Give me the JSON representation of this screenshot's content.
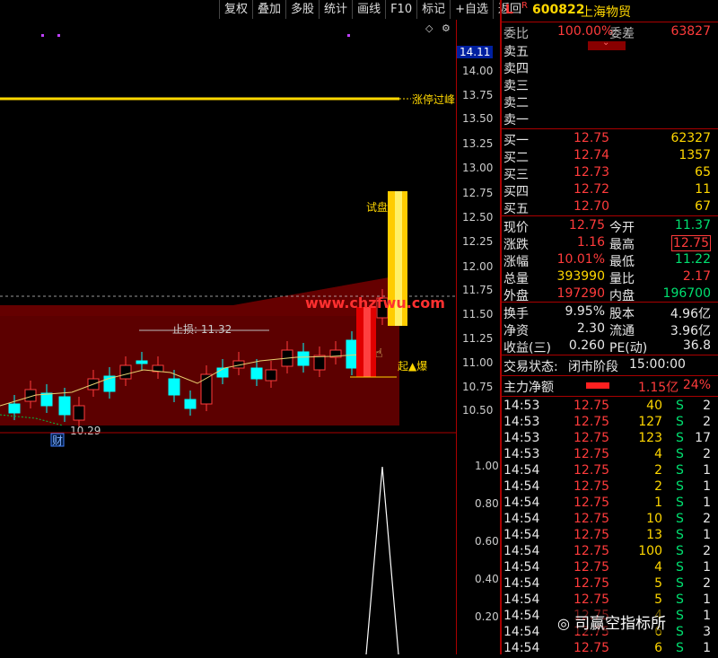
{
  "toolbar": [
    "复权",
    "叠加",
    "多股",
    "统计",
    "画线",
    "F10",
    "标记",
    "+自选",
    "返回"
  ],
  "chart": {
    "price_labels": [
      "14.11",
      "14.00",
      "13.75",
      "13.50",
      "13.25",
      "13.00",
      "12.75",
      "12.50",
      "12.25",
      "12.00",
      "11.75",
      "11.50",
      "11.25",
      "11.00",
      "10.75",
      "10.50"
    ],
    "current_price_tag": "14.11",
    "limit_line_label": "涨停过峰",
    "stop_label": "止损: 11.32",
    "low_label": "10.29",
    "cai_label": "财",
    "test_label": "试盘",
    "burst_label": "起▲爆",
    "watermark": "www.chzfwu.com",
    "indicator_labels": [
      "1.00",
      "0.80",
      "0.60",
      "0.40",
      "0.20"
    ],
    "colors": {
      "limit_line": "#ffd700",
      "up": "#ff3b3b",
      "down": "#00ffff",
      "band": "#5a0000"
    }
  },
  "header": {
    "tag_l": "L",
    "tag_r": "R",
    "code": "600822",
    "name": "上海物贸"
  },
  "weibi": {
    "label": "委比",
    "value": "100.00%",
    "label2": "委差",
    "value2": "63827"
  },
  "sell": [
    {
      "label": "卖五"
    },
    {
      "label": "卖四"
    },
    {
      "label": "卖三"
    },
    {
      "label": "卖二"
    },
    {
      "label": "卖一"
    }
  ],
  "buy": [
    {
      "label": "买一",
      "price": "12.75",
      "vol": "62327"
    },
    {
      "label": "买二",
      "price": "12.74",
      "vol": "1357"
    },
    {
      "label": "买三",
      "price": "12.73",
      "vol": "65"
    },
    {
      "label": "买四",
      "price": "12.72",
      "vol": "11"
    },
    {
      "label": "买五",
      "price": "12.70",
      "vol": "67"
    }
  ],
  "quote": [
    {
      "l1": "现价",
      "v1": "12.75",
      "l2": "今开",
      "v2": "11.37",
      "c1": "red",
      "c2": "green"
    },
    {
      "l1": "涨跌",
      "v1": "1.16",
      "l2": "最高",
      "v2": "12.75",
      "c1": "red",
      "c2": "red"
    },
    {
      "l1": "涨幅",
      "v1": "10.01%",
      "l2": "最低",
      "v2": "11.22",
      "c1": "red",
      "c2": "green"
    },
    {
      "l1": "总量",
      "v1": "393990",
      "l2": "量比",
      "v2": "2.17",
      "c1": "yellow",
      "c2": "red"
    },
    {
      "l1": "外盘",
      "v1": "197290",
      "l2": "内盘",
      "v2": "196700",
      "c1": "red",
      "c2": "green"
    }
  ],
  "stats": [
    {
      "l1": "换手",
      "v1": "9.95%",
      "l2": "股本",
      "v2": "4.96亿"
    },
    {
      "l1": "净资",
      "v1": "2.30",
      "l2": "流通",
      "v2": "3.96亿"
    },
    {
      "l1": "收益(三)",
      "v1": "0.260",
      "l2": "PE(动)",
      "v2": "36.8"
    }
  ],
  "trade_status": {
    "label": "交易状态:",
    "phase": "闭市阶段",
    "time": "15:00:00"
  },
  "main_flow": {
    "label": "主力净额",
    "value": "1.15亿",
    "pct": "24%"
  },
  "ticks": [
    {
      "t": "14:53",
      "p": "12.75",
      "v": "40",
      "s": "S",
      "n": "2"
    },
    {
      "t": "14:53",
      "p": "12.75",
      "v": "127",
      "s": "S",
      "n": "2"
    },
    {
      "t": "14:53",
      "p": "12.75",
      "v": "123",
      "s": "S",
      "n": "17"
    },
    {
      "t": "14:53",
      "p": "12.75",
      "v": "4",
      "s": "S",
      "n": "2"
    },
    {
      "t": "14:54",
      "p": "12.75",
      "v": "2",
      "s": "S",
      "n": "1"
    },
    {
      "t": "14:54",
      "p": "12.75",
      "v": "2",
      "s": "S",
      "n": "1"
    },
    {
      "t": "14:54",
      "p": "12.75",
      "v": "1",
      "s": "S",
      "n": "1"
    },
    {
      "t": "14:54",
      "p": "12.75",
      "v": "10",
      "s": "S",
      "n": "2"
    },
    {
      "t": "14:54",
      "p": "12.75",
      "v": "13",
      "s": "S",
      "n": "1"
    },
    {
      "t": "14:54",
      "p": "12.75",
      "v": "100",
      "s": "S",
      "n": "2"
    },
    {
      "t": "14:54",
      "p": "12.75",
      "v": "4",
      "s": "S",
      "n": "1"
    },
    {
      "t": "14:54",
      "p": "12.75",
      "v": "5",
      "s": "S",
      "n": "2"
    },
    {
      "t": "14:54",
      "p": "12.75",
      "v": "5",
      "s": "S",
      "n": "1"
    },
    {
      "t": "14:54",
      "p": "12.75",
      "v": "4",
      "s": "S",
      "n": "1"
    },
    {
      "t": "14:54",
      "p": "12.75",
      "v": "6",
      "s": "S",
      "n": "3"
    },
    {
      "t": "14:54",
      "p": "12.75",
      "v": "6",
      "s": "S",
      "n": "1"
    }
  ],
  "brand": "司赢空指标所"
}
